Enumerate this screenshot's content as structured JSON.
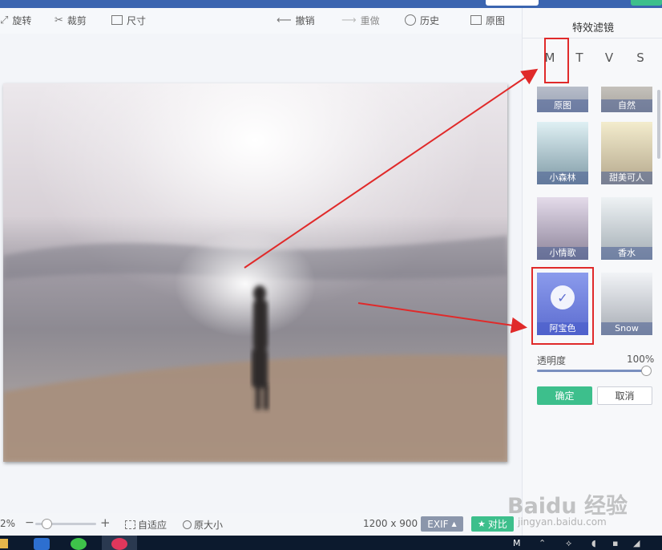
{
  "toolbar": {
    "rotate": "旋转",
    "crop": "裁剪",
    "size": "尺寸",
    "undo": "撤销",
    "redo": "重做",
    "history": "历史",
    "original": "原图"
  },
  "panel": {
    "title": "特效滤镜",
    "tabs": [
      "M",
      "T",
      "V",
      "S"
    ],
    "selected_tab": "M",
    "filters": [
      {
        "label": "原图",
        "selected": false
      },
      {
        "label": "自然",
        "selected": false
      },
      {
        "label": "小森林",
        "selected": false
      },
      {
        "label": "甜美可人",
        "selected": false
      },
      {
        "label": "小情歌",
        "selected": false
      },
      {
        "label": "香水",
        "selected": false
      },
      {
        "label": "阿宝色",
        "selected": true
      },
      {
        "label": "Snow",
        "selected": false
      }
    ],
    "opacity_label": "透明度",
    "opacity_value": "100%",
    "opacity_level": 1.0,
    "confirm": "确定",
    "cancel": "取消"
  },
  "bottom": {
    "zoom": "2%",
    "minus": "−",
    "plus": "+",
    "fit": "自适应",
    "actual": "原大小",
    "dimensions": "1200 x 900",
    "exif": "EXIF",
    "compare": "对比"
  },
  "watermark": {
    "brand": "Baidu 经验",
    "url": "jingyan.baidu.com"
  },
  "colors": {
    "accent_green": "#3dbf8c",
    "top_blue": "#3b65b0",
    "annotation_red": "#e02a2a"
  }
}
